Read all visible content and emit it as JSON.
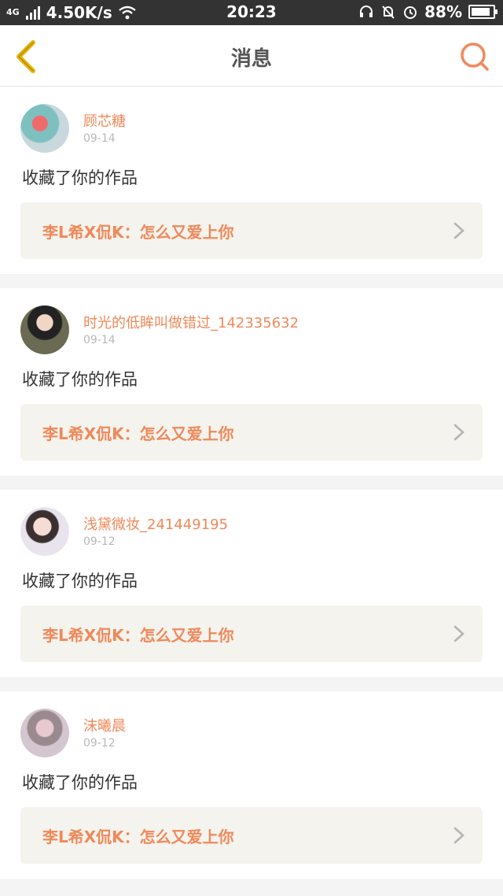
{
  "statusbar": {
    "network": "4G",
    "speed": "4.50K/s",
    "time": "20:23",
    "battery": "88%",
    "battery_level": 0.88
  },
  "navbar": {
    "title": "消息",
    "back_icon": "chevron-left-icon",
    "search_icon": "search-icon"
  },
  "colors": {
    "accent": "#f0895a",
    "back": "#e8b400",
    "card_bg": "#ffffff",
    "work_bg": "#f4f3ee"
  },
  "messages": [
    {
      "name": "顾芯糖",
      "date": "09-14",
      "action": "收藏了你的作品",
      "work": "李L希X侃K：怎么又爱上你"
    },
    {
      "name": "时光的低眸叫做错过_142335632",
      "date": "09-14",
      "action": "收藏了你的作品",
      "work": "李L希X侃K：怎么又爱上你"
    },
    {
      "name": "浅黛微妆_241449195",
      "date": "09-12",
      "action": "收藏了你的作品",
      "work": "李L希X侃K：怎么又爱上你"
    },
    {
      "name": "沫曦晨",
      "date": "09-12",
      "action": "收藏了你的作品",
      "work": "李L希X侃K：怎么又爱上你"
    }
  ]
}
